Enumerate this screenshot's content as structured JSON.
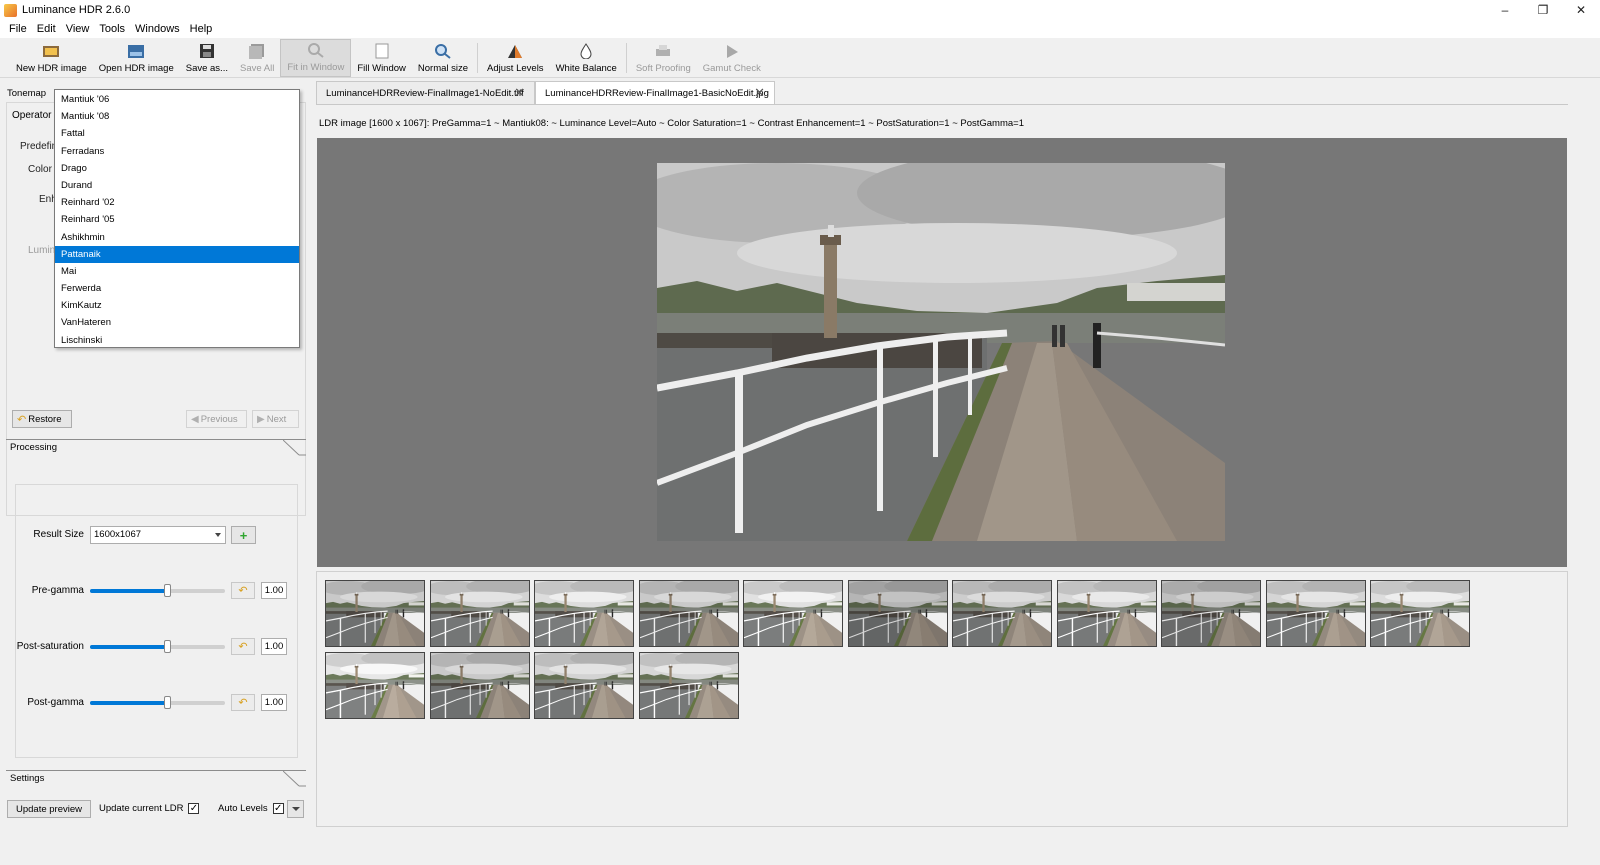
{
  "window": {
    "title": "Luminance HDR 2.6.0",
    "minimize": "–",
    "restore": "❐",
    "close": "✕"
  },
  "menu": [
    "File",
    "Edit",
    "View",
    "Tools",
    "Windows",
    "Help"
  ],
  "toolbar": {
    "new_hdr": "New HDR image",
    "open_hdr": "Open HDR image",
    "save_as": "Save as...",
    "save_all": "Save All",
    "fit_in_window": "Fit in Window",
    "fill_window": "Fill Window",
    "normal_size": "Normal size",
    "adjust_levels": "Adjust Levels",
    "white_balance": "White Balance",
    "soft_proofing": "Soft Proofing",
    "gamut_check": "Gamut Check"
  },
  "tonemap": {
    "tab_label": "Tonemap",
    "operator_label": "Operator",
    "hidden_labels": [
      "Predefin",
      "Color S",
      "Enh",
      "Lumina"
    ],
    "operators": [
      "Mantiuk '06",
      "Mantiuk '08",
      "Fattal",
      "Ferradans",
      "Drago",
      "Durand",
      "Reinhard '02",
      "Reinhard '05",
      "Ashikhmin",
      "Pattanaik",
      "Mai",
      "Ferwerda",
      "KimKautz",
      "VanHateren",
      "Lischinski"
    ],
    "selected_operator": "Pattanaik",
    "restore": "Restore",
    "previous": "Previous",
    "next": "Next"
  },
  "processing": {
    "header": "Processing",
    "result_size_label": "Result Size",
    "result_size_value": "1600x1067",
    "pre_gamma_label": "Pre-gamma",
    "pre_gamma_value": "1.00",
    "post_saturation_label": "Post-saturation",
    "post_saturation_value": "1.00",
    "post_gamma_label": "Post-gamma",
    "post_gamma_value": "1.00",
    "slider_level": 0.58
  },
  "settings": {
    "header": "Settings",
    "update_preview": "Update preview",
    "update_current_ldr": "Update current LDR",
    "auto_levels": "Auto Levels",
    "checkmark": "✓"
  },
  "tabs": [
    {
      "label": "LuminanceHDRReview-FinalImage1-NoEdit.tiff",
      "close": "✕"
    },
    {
      "label": "LuminanceHDRReview-FinalImage1-BasicNoEdit.jpg",
      "close": "✕"
    }
  ],
  "image_info": "LDR image [1600 x 1067]: PreGamma=1 ~ Mantiuk08: ~ Luminance Level=Auto ~ Color Saturation=1 ~ Contrast Enhancement=1 ~ PostSaturation=1 ~ PostGamma=1",
  "thumbnail_count": 15,
  "colors": {
    "accent": "#0078d7",
    "viewer_bg": "#777777"
  }
}
